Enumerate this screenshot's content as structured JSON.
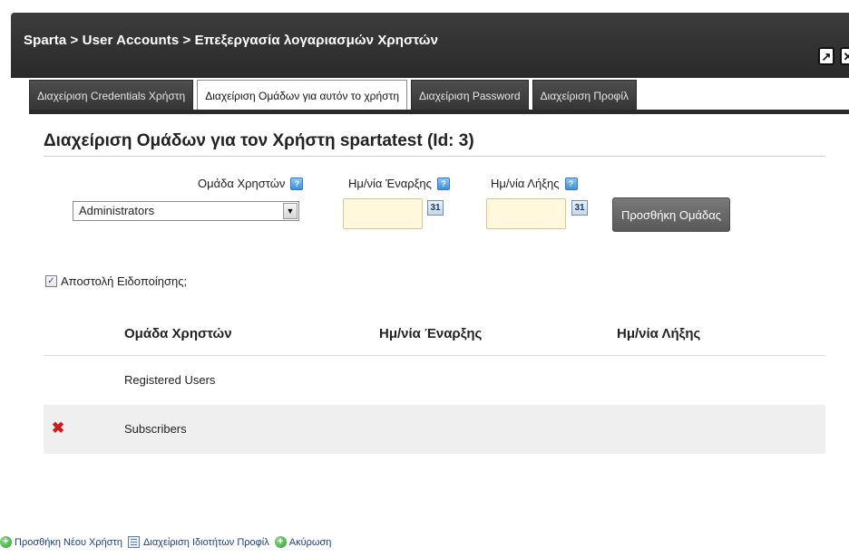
{
  "window": {
    "title": "Sparta > User Accounts > Επεξεργασία λογαριασμών Χρηστών",
    "maximize_glyph": "↗",
    "close_glyph": "✕"
  },
  "tabs": [
    {
      "label": "Διαχείριση Credentials Χρήστη",
      "active": false
    },
    {
      "label": "Διαχείριση Ομάδων για αυτόν το χρήστη",
      "active": true
    },
    {
      "label": "Διαχείριση Password",
      "active": false
    },
    {
      "label": "Διαχείριση Προφίλ",
      "active": false
    }
  ],
  "heading": "Διαχείριση Ομάδων για τον Χρήστη spartatest (Id: 3)",
  "form": {
    "group_label": "Ομάδα Χρηστών",
    "group_value": "Administrators",
    "start_label": "Ημ/νία Έναρξης",
    "start_value": "",
    "end_label": "Ημ/νία Λήξης",
    "end_value": "",
    "calendar_glyph": "31",
    "add_button": "Προσθήκη Ομάδας",
    "notify_label": "Αποστολή Ειδοποίησης;",
    "notify_checked": true
  },
  "table": {
    "headers": [
      "Ομάδα Χρηστών",
      "Ημ/νία Έναρξης",
      "Ημ/νία Λήξης"
    ],
    "rows": [
      {
        "group": "Registered Users",
        "start": "",
        "end": "",
        "deletable": false
      },
      {
        "group": "Subscribers",
        "start": "",
        "end": "",
        "deletable": true
      }
    ]
  },
  "footer": {
    "add_user": "Προσθήκη Νέου Χρήστη",
    "manage_profile_props": "Διαχείριση Ιδιοτήτων Προφίλ",
    "cancel": "Ακύρωση"
  },
  "colors": {
    "titlebar": "#2a2a2a",
    "tab_bg": "#3f3f3f",
    "date_input_bg": "#fff8dc",
    "alt_row": "#efefef",
    "link": "#1b3f8a",
    "delete": "#d11a1a"
  },
  "icons": {
    "help": "help-icon",
    "calendar": "calendar-icon",
    "delete": "delete-x-icon",
    "add": "green-plus-icon",
    "list": "list-icon"
  }
}
